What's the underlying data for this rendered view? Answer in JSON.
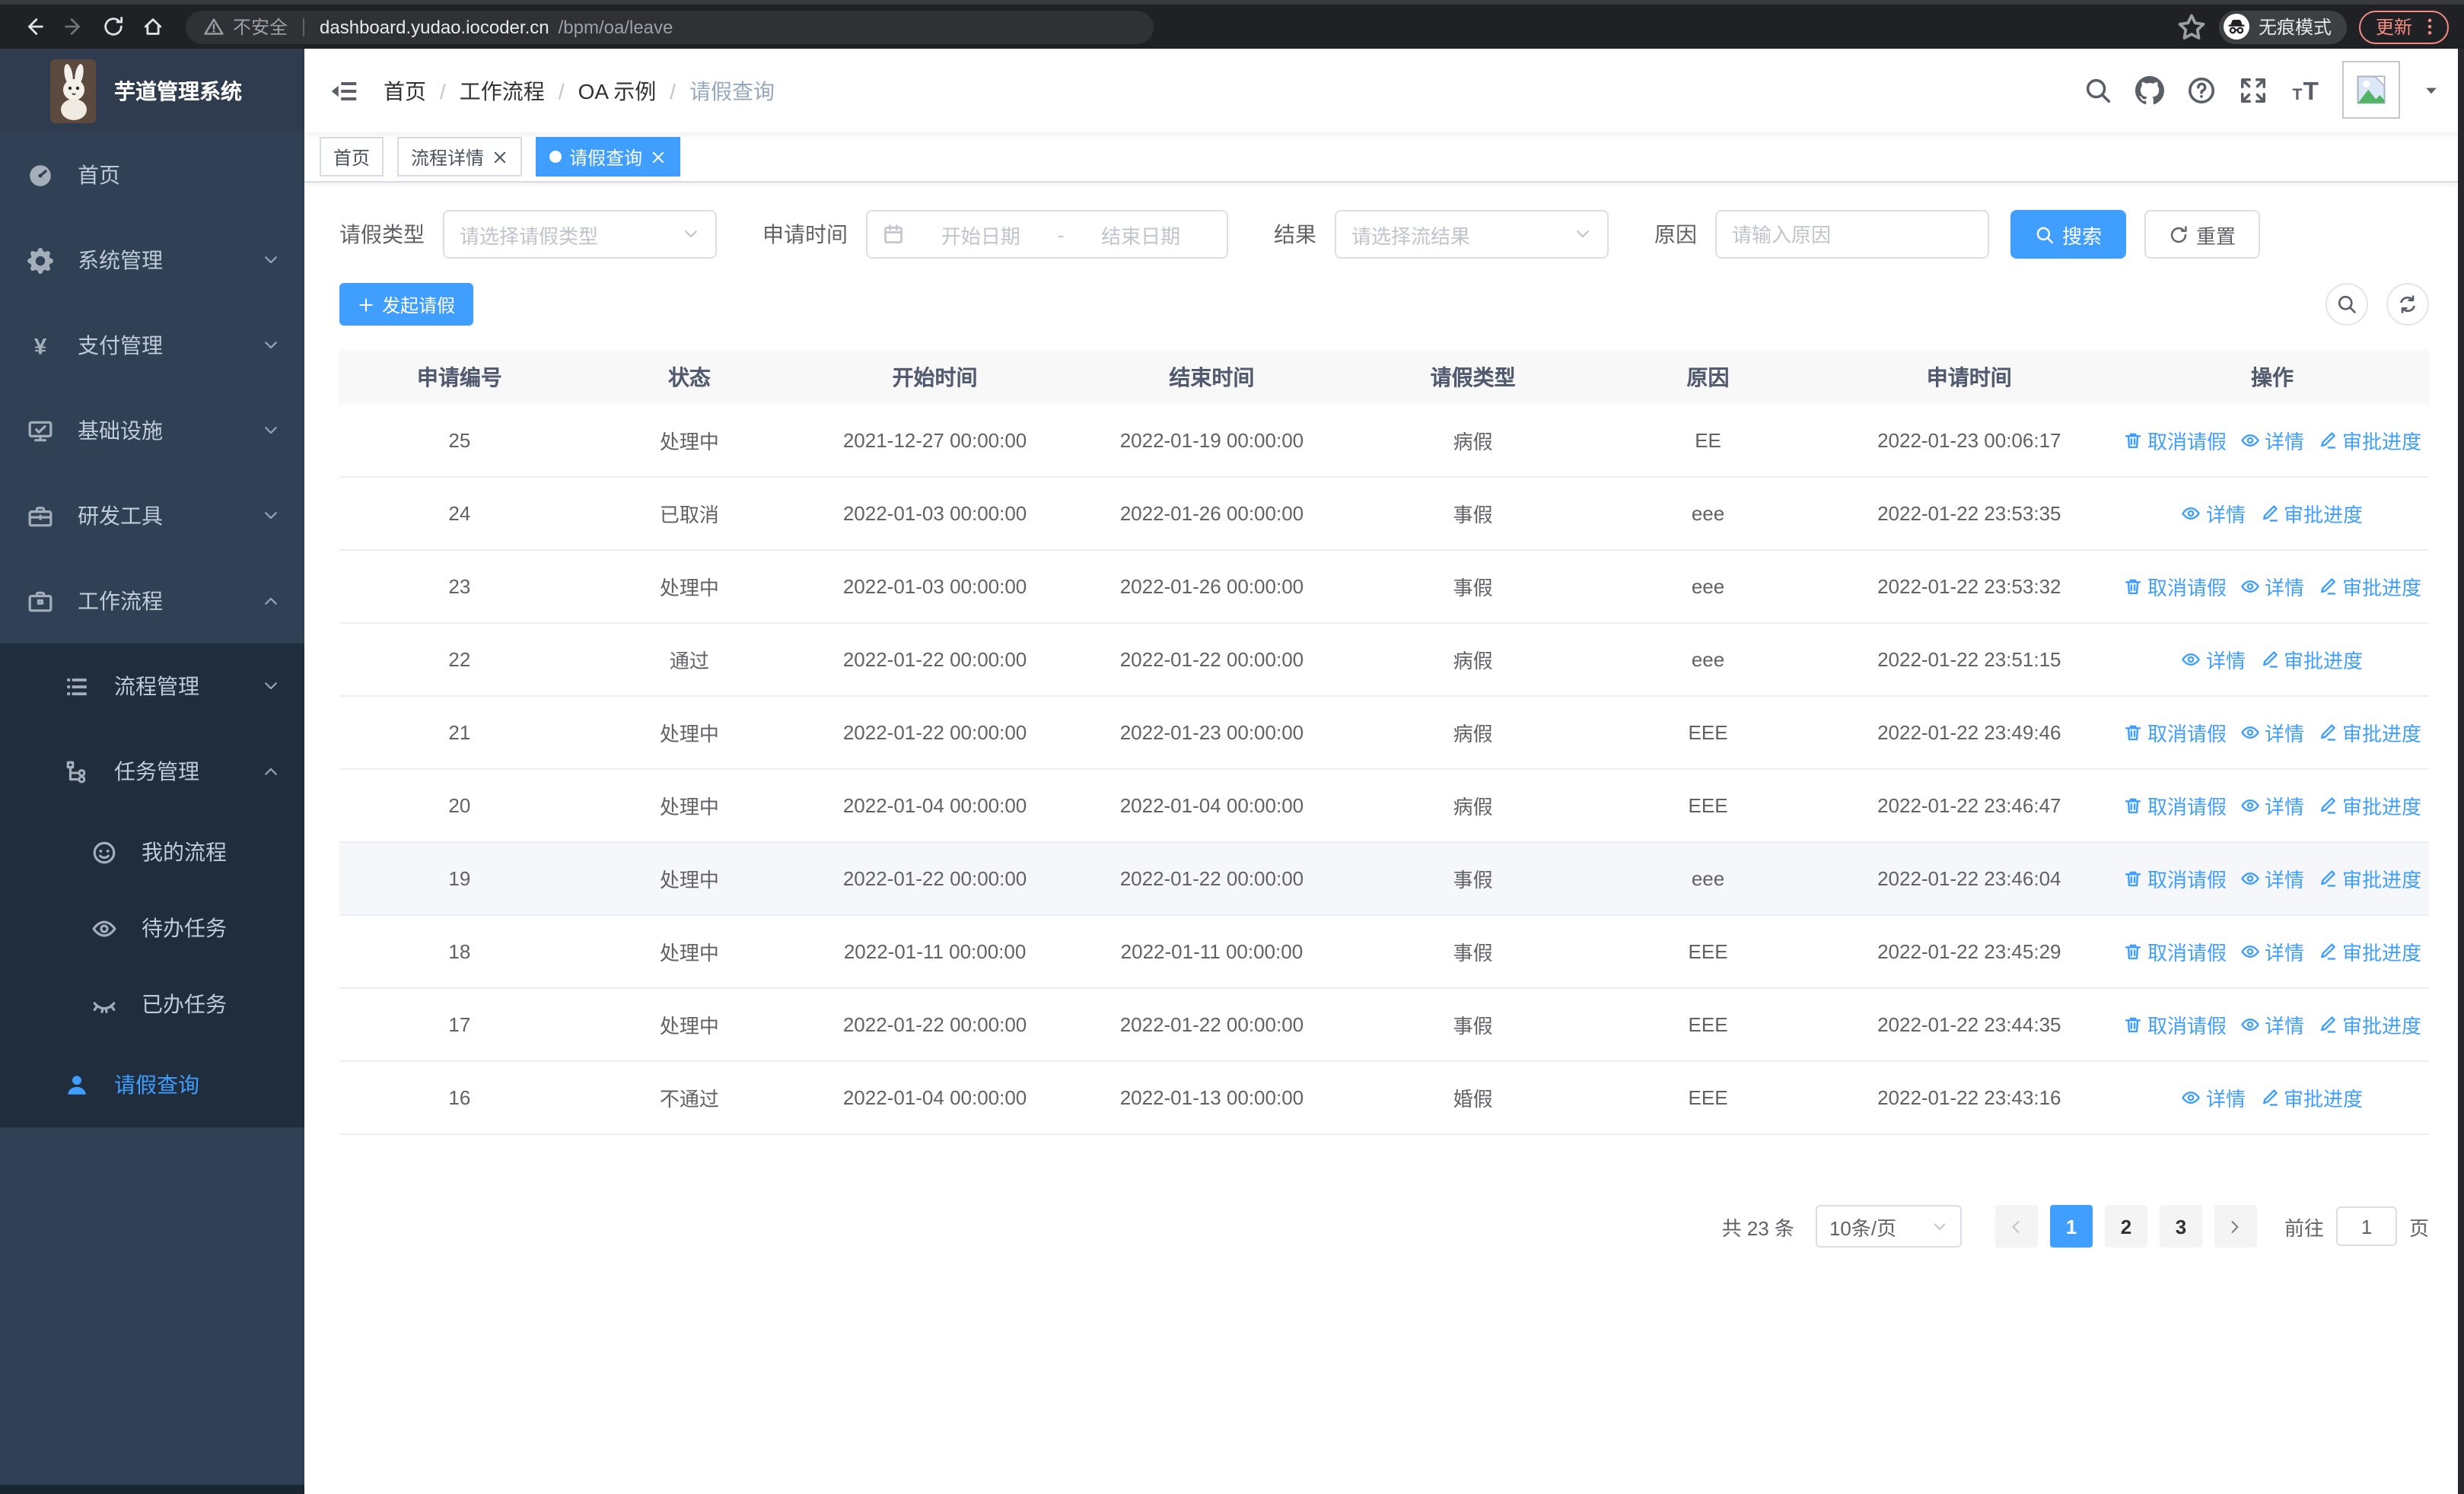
{
  "colors": {
    "accent": "#409eff",
    "sidebar_bg": "#304156",
    "submenu_bg": "#1f2d3d",
    "update_accent": "#f28b82"
  },
  "browser": {
    "security_label": "不安全",
    "url_domain": "dashboard.yudao.iocoder.cn",
    "url_path": "/bpm/oa/leave",
    "incognito_label": "无痕模式",
    "update_label": "更新"
  },
  "sidebar": {
    "app_title": "芋道管理系统",
    "menu": [
      {
        "name": "home",
        "label": "首页",
        "icon": "dashboard-icon",
        "arrow": ""
      },
      {
        "name": "system-management",
        "label": "系统管理",
        "icon": "gear-icon",
        "arrow": "down"
      },
      {
        "name": "payment-management",
        "label": "支付管理",
        "icon": "yen-icon",
        "arrow": "down"
      },
      {
        "name": "infrastructure",
        "label": "基础设施",
        "icon": "monitor-icon",
        "arrow": "down"
      },
      {
        "name": "dev-tools",
        "label": "研发工具",
        "icon": "toolbox-icon",
        "arrow": "down"
      },
      {
        "name": "workflow",
        "label": "工作流程",
        "icon": "briefcase-icon",
        "arrow": "up"
      }
    ],
    "submenu": [
      {
        "name": "process-management",
        "label": "流程管理",
        "icon": "list-tree-icon",
        "level": 2,
        "arrow": "down",
        "active": false
      },
      {
        "name": "task-management",
        "label": "任务管理",
        "icon": "tree-icon",
        "level": 2,
        "arrow": "up",
        "active": false
      },
      {
        "name": "my-processes",
        "label": "我的流程",
        "icon": "face-icon",
        "level": 3,
        "arrow": "",
        "active": false
      },
      {
        "name": "todo-tasks",
        "label": "待办任务",
        "icon": "eye-icon",
        "level": 3,
        "arrow": "",
        "active": false
      },
      {
        "name": "done-tasks",
        "label": "已办任务",
        "icon": "eye-closed-icon",
        "level": 3,
        "arrow": "",
        "active": false
      },
      {
        "name": "leave-query",
        "label": "请假查询",
        "icon": "user-icon",
        "level": 2,
        "arrow": "",
        "active": true
      }
    ]
  },
  "header": {
    "breadcrumb": [
      {
        "name": "home",
        "label": "首页",
        "current": false
      },
      {
        "name": "workflow",
        "label": "工作流程",
        "current": false
      },
      {
        "name": "oa-example",
        "label": "OA 示例",
        "current": false
      },
      {
        "name": "leave-query",
        "label": "请假查询",
        "current": true
      }
    ]
  },
  "tabs": [
    {
      "name": "home",
      "label": "首页",
      "closable": false,
      "active": false
    },
    {
      "name": "process-detail",
      "label": "流程详情",
      "closable": true,
      "active": false
    },
    {
      "name": "leave-query",
      "label": "请假查询",
      "closable": true,
      "active": true
    }
  ],
  "filters": {
    "leave_type_label": "请假类型",
    "leave_type_placeholder": "请选择请假类型",
    "apply_time_label": "申请时间",
    "date_start_placeholder": "开始日期",
    "date_separator": "-",
    "date_end_placeholder": "结束日期",
    "result_label": "结果",
    "result_placeholder": "请选择流结果",
    "reason_label": "原因",
    "reason_placeholder": "请输入原因",
    "search_label": "搜索",
    "reset_label": "重置"
  },
  "toolbar": {
    "create_label": "发起请假"
  },
  "table": {
    "columns": [
      "申请编号",
      "状态",
      "开始时间",
      "结束时间",
      "请假类型",
      "原因",
      "申请时间",
      "操作"
    ],
    "action_labels": {
      "cancel": "取消请假",
      "detail": "详情",
      "progress": "审批进度"
    },
    "rows": [
      {
        "id": "25",
        "status": "处理中",
        "start": "2021-12-27 00:00:00",
        "end": "2022-01-19 00:00:00",
        "type": "病假",
        "reason": "EE",
        "apply_time": "2022-01-23 00:06:17",
        "actions": [
          "cancel",
          "detail",
          "progress"
        ],
        "highlighted": false
      },
      {
        "id": "24",
        "status": "已取消",
        "start": "2022-01-03 00:00:00",
        "end": "2022-01-26 00:00:00",
        "type": "事假",
        "reason": "eee",
        "apply_time": "2022-01-22 23:53:35",
        "actions": [
          "detail",
          "progress"
        ],
        "highlighted": false
      },
      {
        "id": "23",
        "status": "处理中",
        "start": "2022-01-03 00:00:00",
        "end": "2022-01-26 00:00:00",
        "type": "事假",
        "reason": "eee",
        "apply_time": "2022-01-22 23:53:32",
        "actions": [
          "cancel",
          "detail",
          "progress"
        ],
        "highlighted": false
      },
      {
        "id": "22",
        "status": "通过",
        "start": "2022-01-22 00:00:00",
        "end": "2022-01-22 00:00:00",
        "type": "病假",
        "reason": "eee",
        "apply_time": "2022-01-22 23:51:15",
        "actions": [
          "detail",
          "progress"
        ],
        "highlighted": false
      },
      {
        "id": "21",
        "status": "处理中",
        "start": "2022-01-22 00:00:00",
        "end": "2022-01-23 00:00:00",
        "type": "病假",
        "reason": "EEE",
        "apply_time": "2022-01-22 23:49:46",
        "actions": [
          "cancel",
          "detail",
          "progress"
        ],
        "highlighted": false
      },
      {
        "id": "20",
        "status": "处理中",
        "start": "2022-01-04 00:00:00",
        "end": "2022-01-04 00:00:00",
        "type": "病假",
        "reason": "EEE",
        "apply_time": "2022-01-22 23:46:47",
        "actions": [
          "cancel",
          "detail",
          "progress"
        ],
        "highlighted": false
      },
      {
        "id": "19",
        "status": "处理中",
        "start": "2022-01-22 00:00:00",
        "end": "2022-01-22 00:00:00",
        "type": "事假",
        "reason": "eee",
        "apply_time": "2022-01-22 23:46:04",
        "actions": [
          "cancel",
          "detail",
          "progress"
        ],
        "highlighted": true
      },
      {
        "id": "18",
        "status": "处理中",
        "start": "2022-01-11 00:00:00",
        "end": "2022-01-11 00:00:00",
        "type": "事假",
        "reason": "EEE",
        "apply_time": "2022-01-22 23:45:29",
        "actions": [
          "cancel",
          "detail",
          "progress"
        ],
        "highlighted": false
      },
      {
        "id": "17",
        "status": "处理中",
        "start": "2022-01-22 00:00:00",
        "end": "2022-01-22 00:00:00",
        "type": "事假",
        "reason": "EEE",
        "apply_time": "2022-01-22 23:44:35",
        "actions": [
          "cancel",
          "detail",
          "progress"
        ],
        "highlighted": false
      },
      {
        "id": "16",
        "status": "不通过",
        "start": "2022-01-04 00:00:00",
        "end": "2022-01-13 00:00:00",
        "type": "婚假",
        "reason": "EEE",
        "apply_time": "2022-01-22 23:43:16",
        "actions": [
          "detail",
          "progress"
        ],
        "highlighted": false
      }
    ]
  },
  "pagination": {
    "total_label": "共 23 条",
    "page_size_label": "10条/页",
    "pages": [
      "1",
      "2",
      "3"
    ],
    "active_page": "1",
    "jump_prefix": "前往",
    "jump_value": "1",
    "jump_suffix": "页"
  }
}
